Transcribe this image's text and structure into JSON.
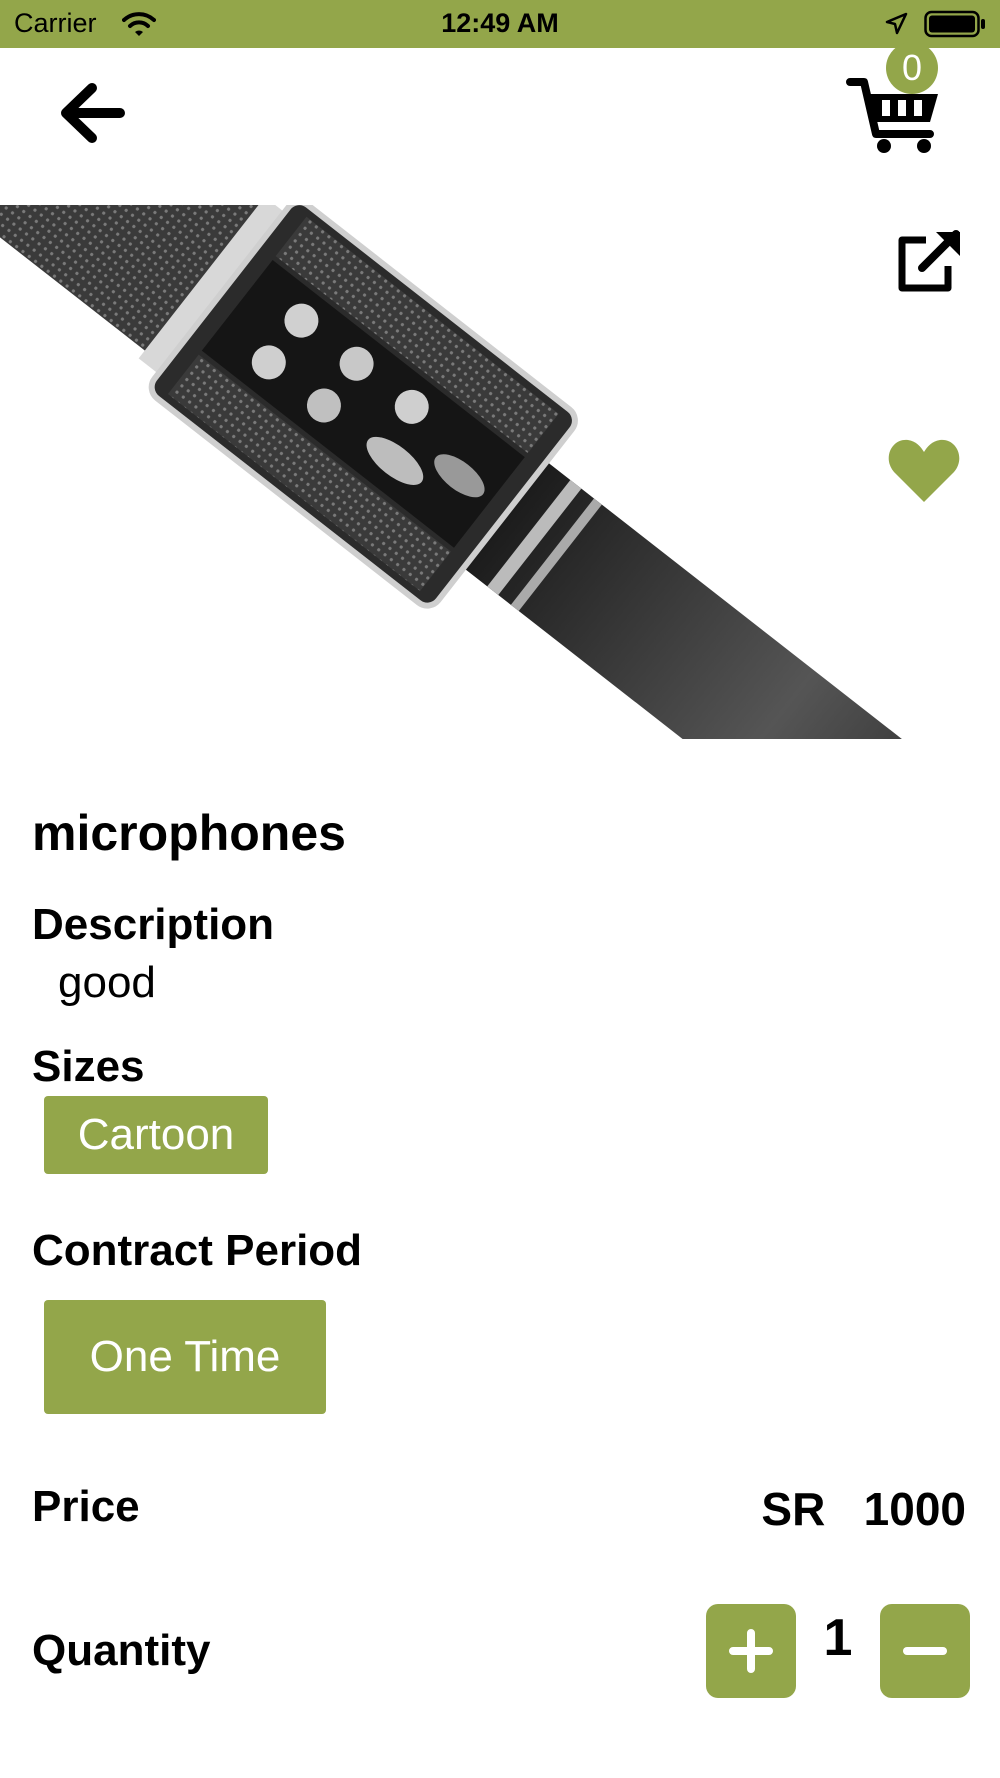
{
  "status_bar": {
    "carrier": "Carrier",
    "time": "12:49 AM"
  },
  "nav": {
    "back_icon": "arrow-left-icon",
    "cart_icon": "cart-icon",
    "cart_count": "0"
  },
  "product": {
    "image": "microphone-photo",
    "share_icon": "external-link-icon",
    "favorite_icon": "heart-icon",
    "title": "microphones",
    "description_label": "Description",
    "description": "good",
    "sizes_label": "Sizes",
    "sizes": [
      "Cartoon"
    ],
    "contract_period_label": "Contract Period",
    "contract_periods": [
      "One Time"
    ],
    "price_label": "Price",
    "price": "SR   1000",
    "quantity_label": "Quantity",
    "quantity": "1"
  },
  "colors": {
    "accent": "#93a64a",
    "text": "#000000",
    "background": "#ffffff"
  }
}
